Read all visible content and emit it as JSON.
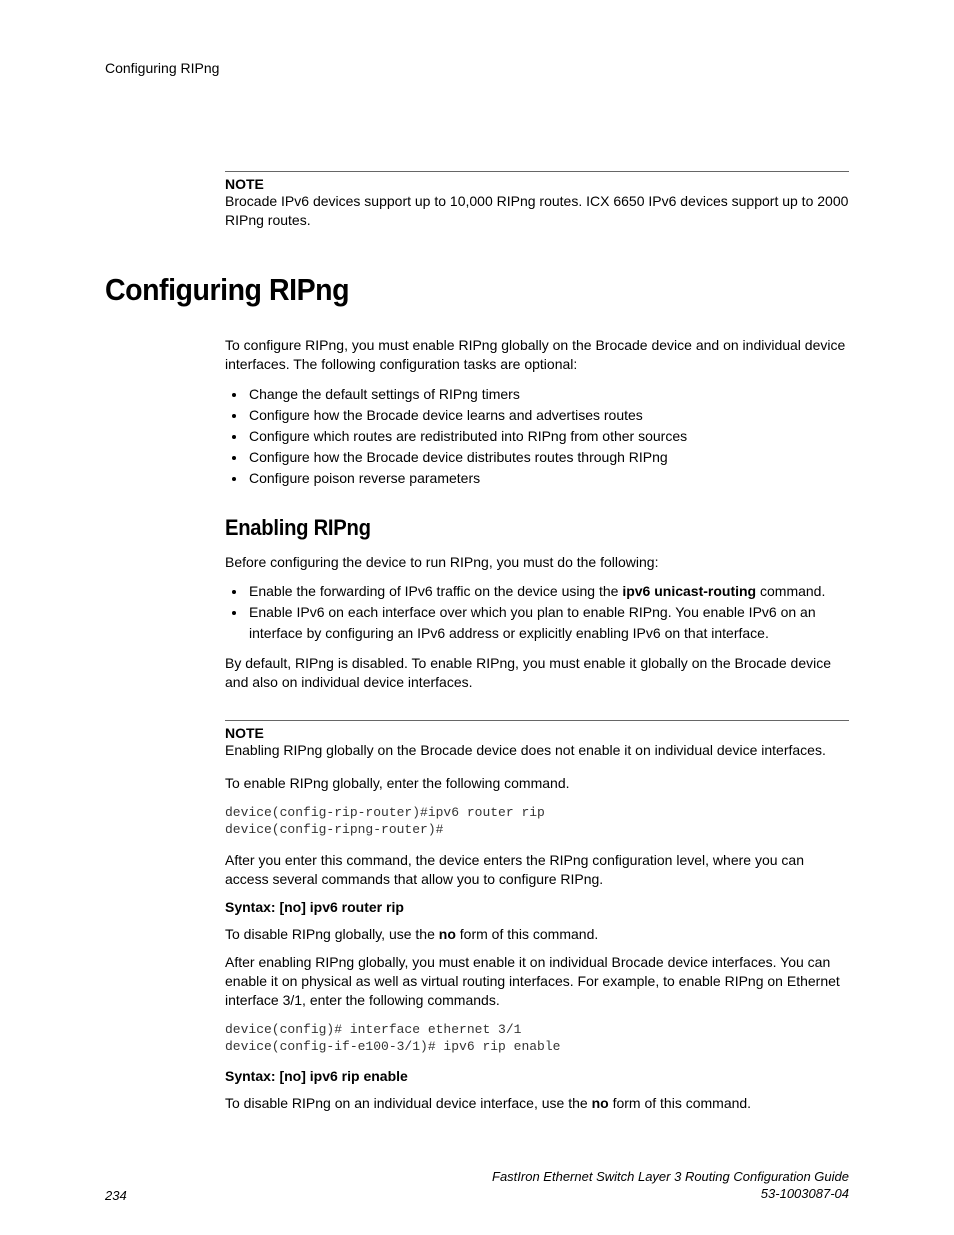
{
  "header": {
    "running_head": "Configuring RIPng"
  },
  "note1": {
    "label": "NOTE",
    "text": "Brocade IPv6 devices support up to 10,000 RIPng routes. ICX 6650 IPv6 devices support up to 2000 RIPng routes."
  },
  "title": "Configuring RIPng",
  "intro": "To configure RIPng, you must enable RIPng globally on the Brocade device and on individual device interfaces. The following configuration tasks are optional:",
  "bullets1": [
    "Change the default settings of RIPng timers",
    "Configure how the Brocade device learns and advertises routes",
    "Configure which routes are redistributed into RIPng from other sources",
    "Configure how the Brocade device distributes routes through RIPng",
    "Configure poison reverse parameters"
  ],
  "subtitle": "Enabling RIPng",
  "before_text": "Before configuring the device to run RIPng, you must do the following:",
  "bullets2": [
    {
      "pre": "Enable the forwarding of IPv6 traffic on the device using the ",
      "bold": "ipv6 unicast-routing",
      "post": " command."
    },
    {
      "pre": "Enable IPv6 on each interface over which you plan to enable RIPng. You enable IPv6 on an interface by configuring an IPv6 address or explicitly enabling IPv6 on that interface.",
      "bold": "",
      "post": ""
    }
  ],
  "default_text": "By default, RIPng is disabled. To enable RIPng, you must enable it globally on the Brocade device and also on individual device interfaces.",
  "note2": {
    "label": "NOTE",
    "text": "Enabling RIPng globally on the Brocade device does not enable it on individual device interfaces."
  },
  "enable_text": "To enable RIPng globally, enter the following command.",
  "code1": "device(config-rip-router)#ipv6 router rip\ndevice(config-ripng-router)#",
  "after_code1": "After you enter this command, the device enters the RIPng configuration level, where you can access several commands that allow you to configure RIPng.",
  "syntax1": "Syntax: [no] ipv6 router rip",
  "disable_global": {
    "pre": "To disable RIPng globally, use the ",
    "bold": "no",
    "post": " form of this command."
  },
  "after_enable": "After enabling RIPng globally, you must enable it on individual Brocade device interfaces. You can enable it on physical as well as virtual routing interfaces. For example, to enable RIPng on Ethernet interface 3/1, enter the following commands.",
  "code2": "device(config)# interface ethernet 3/1\ndevice(config-if-e100-3/1)# ipv6 rip enable",
  "syntax2": "Syntax: [no] ipv6 rip enable",
  "disable_iface": {
    "pre": "To disable RIPng on an individual device interface, use the ",
    "bold": "no",
    "post": " form of this command."
  },
  "footer": {
    "page": "234",
    "doc_title": "FastIron Ethernet Switch Layer 3 Routing Configuration Guide",
    "doc_id": "53-1003087-04"
  }
}
